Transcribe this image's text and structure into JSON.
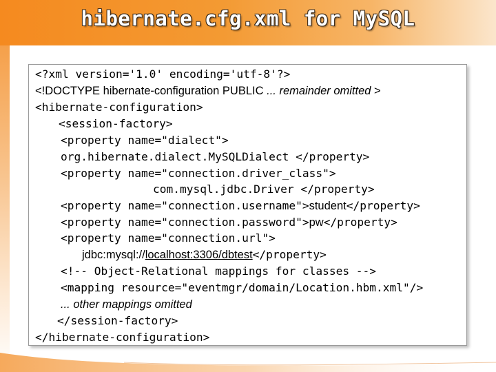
{
  "slide": {
    "title": "hibernate.cfg.xml for MySQL"
  },
  "code": {
    "l1": "<?xml version='1.0' encoding='utf-8'?>",
    "l2_prefix": "<!DOCTYPE hibernate-configuration PUBLIC ",
    "l2_italic": "... remainder omitted",
    "l2_suffix": " >",
    "l3": "<hibernate-configuration>",
    "l4": "<session-factory>",
    "l5": "<property name=\"dialect\">",
    "l6": "org.hibernate.dialect.MySQLDialect </property>",
    "l7": "<property name=\"connection.driver_class\">",
    "l8": "com.mysql.jdbc.Driver </property>",
    "l9_prefix": "<property name=\"connection.username\">",
    "l9_value": "student",
    "l9_suffix": "</property>",
    "l10_prefix": "<property name=\"connection.password\">",
    "l10_value": "pw",
    "l10_suffix": "</property>",
    "l11": "<property name=\"connection.url\">",
    "l12_prefix": "jdbc:mysql://",
    "l12_link": "localhost:3306/dbtest",
    "l12_suffix": "</property>",
    "l13": "<!-- Object-Relational mappings for classes -->",
    "l14": "<mapping resource=\"eventmgr/domain/Location.hbm.xml\"/>",
    "l15": "... other mappings omitted",
    "l16": "</session-factory>",
    "l17": "</hibernate-configuration>"
  }
}
